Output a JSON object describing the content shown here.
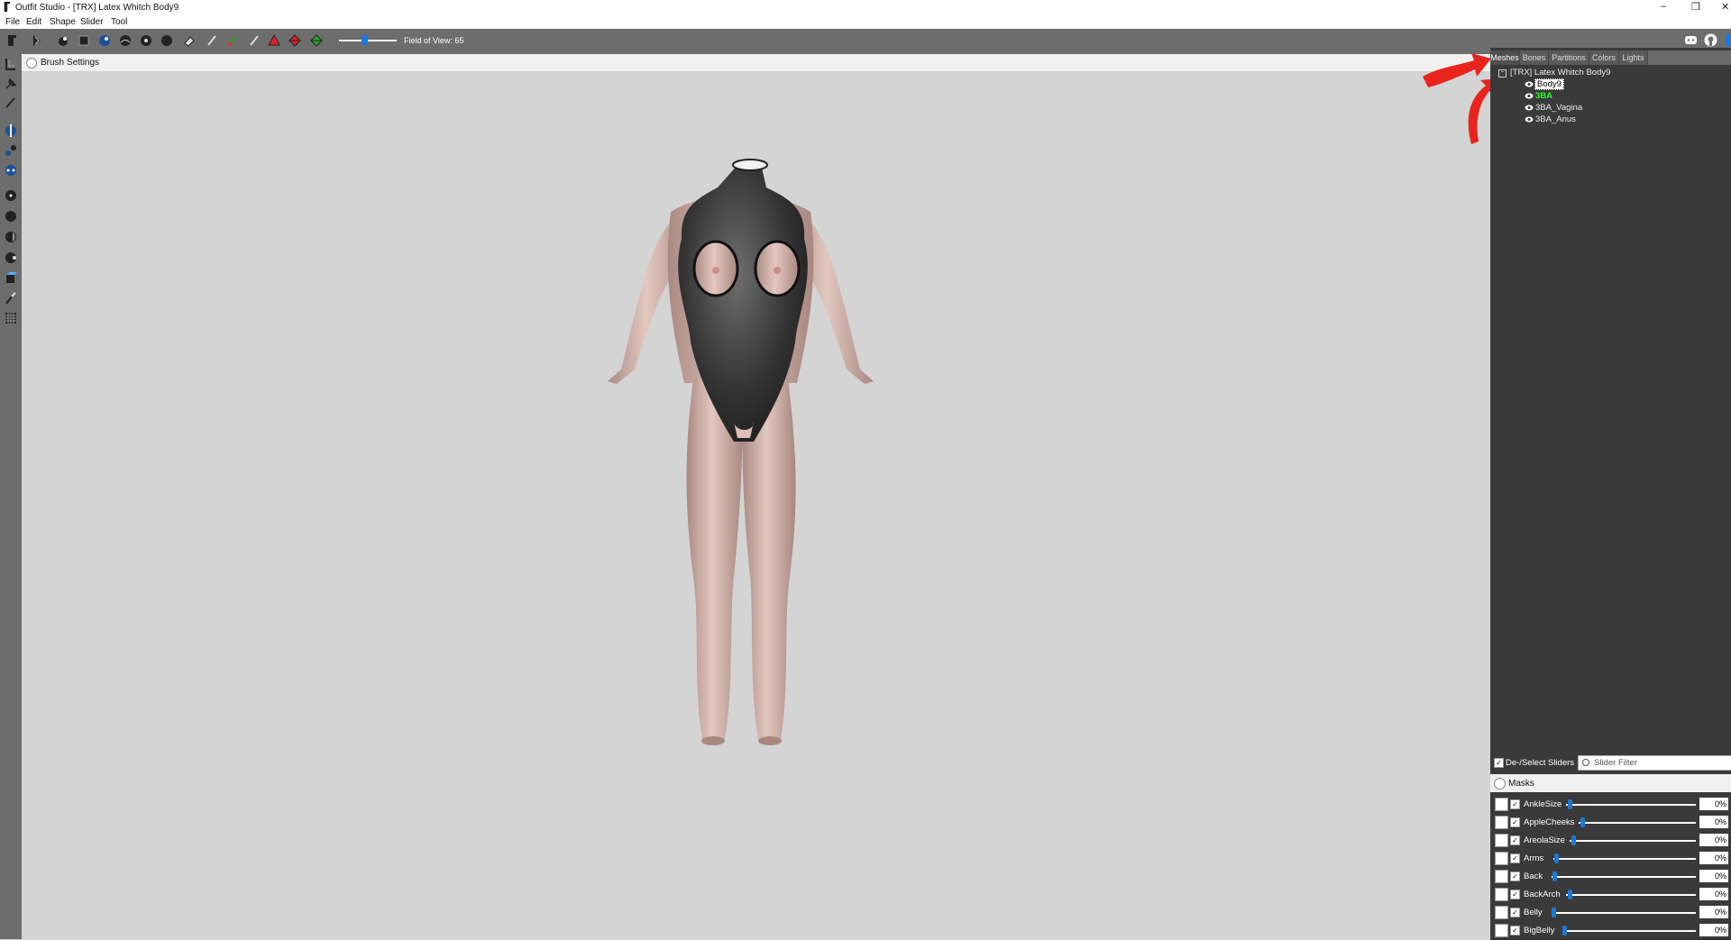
{
  "window": {
    "title": "Outfit Studio - [TRX] Latex Whitch Body9",
    "controls": {
      "minimize": "–",
      "restore": "❐",
      "close": "✕"
    }
  },
  "menu": [
    "File",
    "Edit",
    "Shape",
    "Slider",
    "Tool"
  ],
  "toolbar": {
    "fov_label": "Field of View: 65",
    "fov_value": 65
  },
  "brush_settings": {
    "label": "Brush Settings"
  },
  "tabs": [
    "Meshes",
    "Bones",
    "Partitions",
    "Colors",
    "Lights"
  ],
  "active_tab": "Meshes",
  "mesh_tree": {
    "root": "[TRX] Latex Whitch Body9",
    "items": [
      {
        "name": "Body9",
        "selected": true
      },
      {
        "name": "3BA",
        "highlight": "green"
      },
      {
        "name": "3BA_Vagina"
      },
      {
        "name": "3BA_Anus"
      }
    ]
  },
  "sliders_panel": {
    "deselect_label": "De-/Select Sliders",
    "filter_placeholder": "Slider Filter",
    "masks_label": "Masks",
    "sliders": [
      {
        "name": "AnkleSize",
        "value": "0%"
      },
      {
        "name": "AppleCheeks",
        "value": "0%"
      },
      {
        "name": "AreolaSize",
        "value": "0%"
      },
      {
        "name": "Arms",
        "value": "0%"
      },
      {
        "name": "Back",
        "value": "0%"
      },
      {
        "name": "BackArch",
        "value": "0%"
      },
      {
        "name": "Belly",
        "value": "0%"
      },
      {
        "name": "BigBelly",
        "value": "0%"
      }
    ]
  },
  "colors": {
    "accent": "#1e78d6",
    "toolbar_bg": "#6d6d6d",
    "panel_bg": "#3a3a3a",
    "viewport_bg": "#d4d4d4",
    "annotation_arrow": "#e8241c",
    "highlight_mesh": "#2aff2a"
  }
}
